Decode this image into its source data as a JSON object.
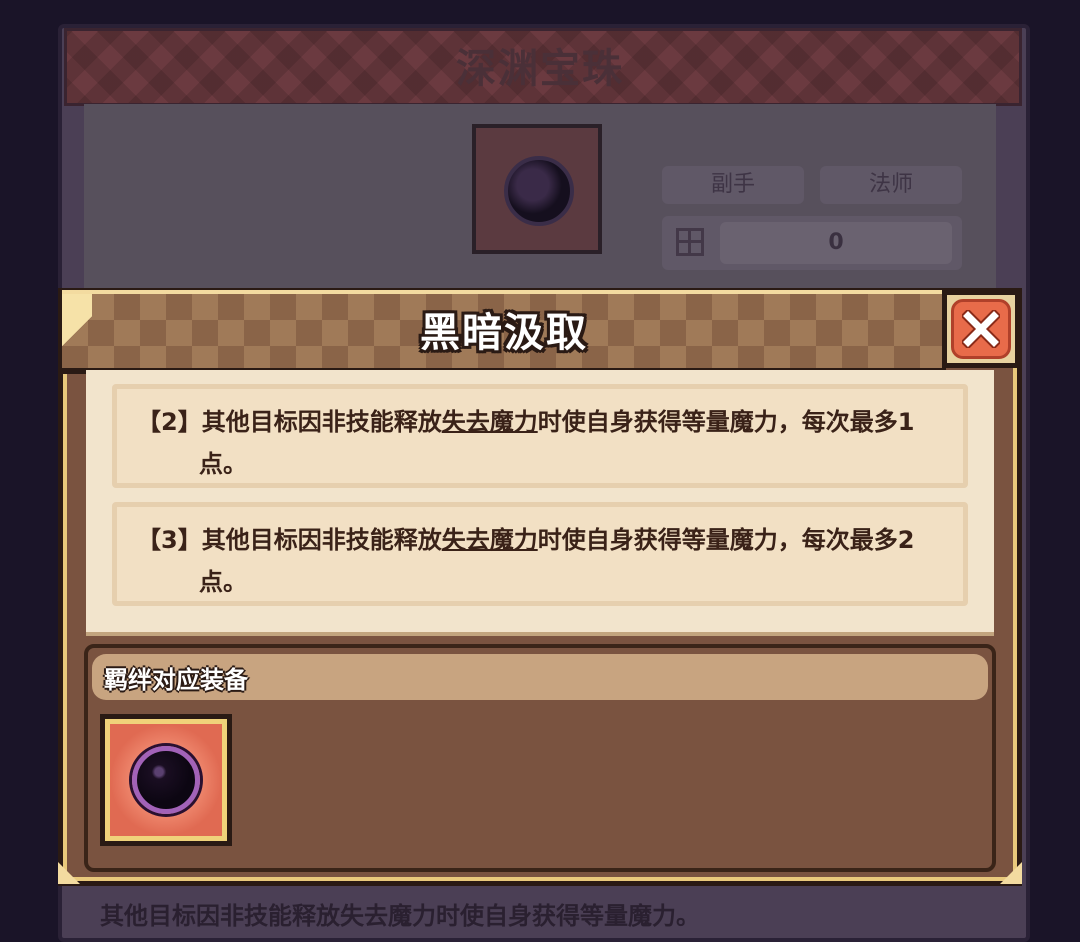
{
  "item_panel": {
    "title": "深渊宝珠",
    "tags": [
      "副手",
      "法师"
    ],
    "count": "0",
    "footer_text": "其他目标因非技能释放失去魔力时使自身获得等量魔力。"
  },
  "popup": {
    "title": "黑暗汲取",
    "effects": [
      {
        "tier": "【2】",
        "prefix": "其他目标因非技能释放",
        "keyword": "失去魔力",
        "suffix": "时使自身获得等量魔力，每次最多1点。"
      },
      {
        "tier": "【3】",
        "prefix": "其他目标因非技能释放",
        "keyword": "失去魔力",
        "suffix": "时使自身获得等量魔力，每次最多2点。"
      }
    ],
    "bond_section_title": "羁绊对应装备",
    "bond_items": [
      {
        "icon": "dark-orb-icon"
      }
    ],
    "close_icon": "close-x-icon"
  },
  "colors": {
    "accent_gold": "#e9c97c",
    "close_red": "#e86b4a",
    "orb_purple": "#a262b8"
  }
}
